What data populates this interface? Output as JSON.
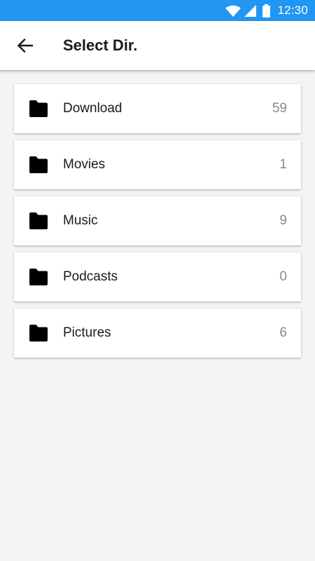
{
  "status_bar": {
    "time": "12:30",
    "color": "#2196F3"
  },
  "app_bar": {
    "title": "Select Dir."
  },
  "directories": [
    {
      "name": "Download",
      "count": "59"
    },
    {
      "name": "Movies",
      "count": "1"
    },
    {
      "name": "Music",
      "count": "9"
    },
    {
      "name": "Podcasts",
      "count": "0"
    },
    {
      "name": "Pictures",
      "count": "6"
    }
  ]
}
